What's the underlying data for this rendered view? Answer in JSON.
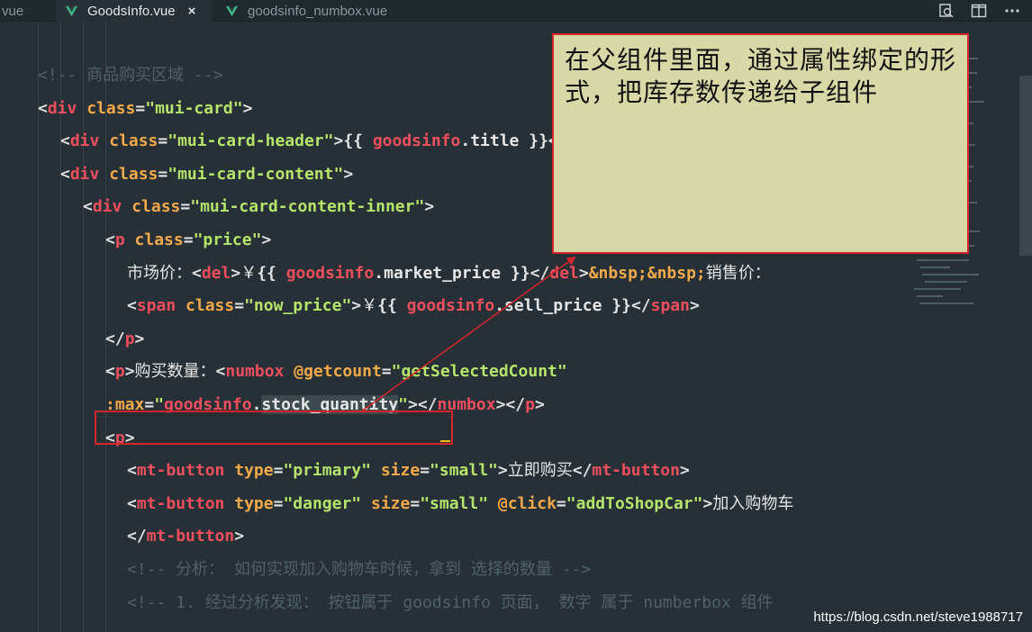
{
  "tabs": [
    {
      "label": "vue",
      "active": false
    },
    {
      "label": "GoodsInfo.vue",
      "active": true,
      "close_glyph": "×"
    },
    {
      "label": "goodsinfo_numbox.vue",
      "active": false
    }
  ],
  "tab_actions": [
    "search-icon",
    "split-editor-icon",
    "more-actions-icon"
  ],
  "code_lines": [
    "<!-- 商品购买区域 -->",
    "<div class=\"mui-card\">",
    "<div class=\"mui-card-header\">{{ goodsinfo.title }}</div>",
    "<div class=\"mui-card-content\">",
    "<div class=\"mui-card-content-inner\">",
    "<p class=\"price\">",
    "市场价：<del>￥{{ goodsinfo.market_price }}</del>&nbsp;&nbsp;销售价：",
    "<span class=\"now_price\">￥{{ goodsinfo.sell_price }}</span>",
    "</p>",
    "<p>购买数量：<numbox @getcount=\"getSelectedCount\"",
    ":max=\"goodsinfo.stock_quantity\"></numbox></p>",
    "<p>",
    "<mt-button type=\"primary\" size=\"small\">立即购买</mt-button>",
    "<mt-button type=\"danger\" size=\"small\" @click=\"addToShopCar\">加入购物车",
    "</mt-button>",
    "<!-- 分析： 如何实现加入购物车时候，拿到 选择的数量 -->",
    "<!-- 1. 经过分析发现： 按钮属于 goodsinfo 页面， 数字 属于 numberbox 组件"
  ],
  "note": {
    "text": "在父组件里面，通过属性绑定的形式，把库存数传递给子组件"
  },
  "watermark": "https://blog.csdn.net/steve1988717",
  "colors": {
    "background": "#263036",
    "tag": "#ef4e5d",
    "attribute": "#f4a94a",
    "string": "#b5e46b",
    "comment": "#4f6169",
    "note_background": "#d7d8a6",
    "highlight_border": "#d4262b"
  }
}
